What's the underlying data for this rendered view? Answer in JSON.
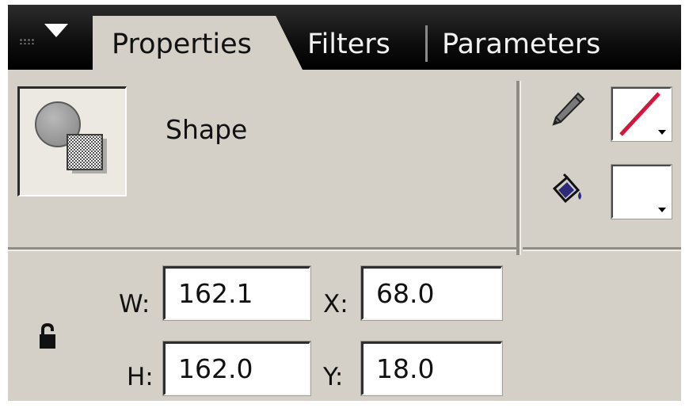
{
  "tabs": {
    "active": "Properties",
    "filters": "Filters",
    "parameters": "Parameters"
  },
  "panel": {
    "menu_icon": "triangle-down-icon",
    "grip_icon": "drag-grip-icon"
  },
  "selection": {
    "type_label": "Shape",
    "type_icon": "shape-icon"
  },
  "stroke": {
    "tool_icon": "pencil-icon",
    "swatch_icon": "no-color-slash-icon",
    "color": "#d4163c"
  },
  "fill": {
    "tool_icon": "paint-bucket-icon",
    "color": "#ffffff"
  },
  "dimensions": {
    "w_label": "W:",
    "w_value": "162.1",
    "h_label": "H:",
    "h_value": "162.0",
    "x_label": "X:",
    "x_value": "68.0",
    "y_label": "Y:",
    "y_value": "18.0",
    "lock_icon": "unlocked-padlock-icon"
  }
}
